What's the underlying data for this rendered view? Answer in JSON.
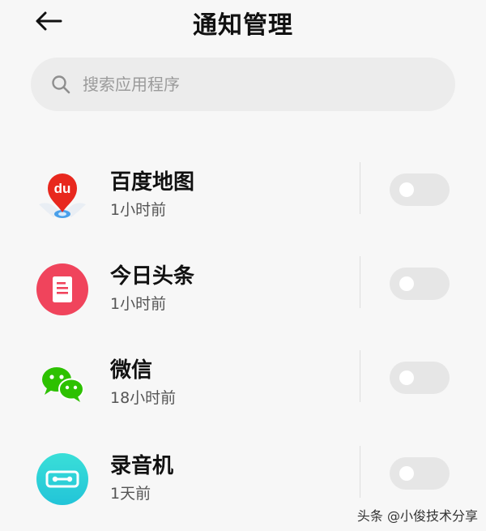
{
  "header": {
    "title": "通知管理",
    "back_icon": "arrow-left-icon"
  },
  "search": {
    "placeholder": "搜索应用程序",
    "value": "",
    "icon": "search-icon"
  },
  "apps": [
    {
      "name": "百度地图",
      "time": "1小时前",
      "icon": "baidu-maps-icon",
      "notifications_enabled": false
    },
    {
      "name": "今日头条",
      "time": "1小时前",
      "icon": "toutiao-icon",
      "notifications_enabled": false
    },
    {
      "name": "微信",
      "time": "18小时前",
      "icon": "wechat-icon",
      "notifications_enabled": false
    },
    {
      "name": "录音机",
      "time": "1天前",
      "icon": "recorder-icon",
      "notifications_enabled": false
    }
  ],
  "watermark": "头条 @小俊技术分享",
  "colors": {
    "background": "#f7f7f7",
    "search_bg": "#ececec",
    "toggle_off": "#e6e6e6",
    "baidu_red": "#e8281e",
    "toutiao_red": "#f0445c",
    "wechat_green": "#2dc100",
    "recorder_cyan": "#2ed3d6"
  },
  "logo_text": {
    "baidu": "du"
  }
}
